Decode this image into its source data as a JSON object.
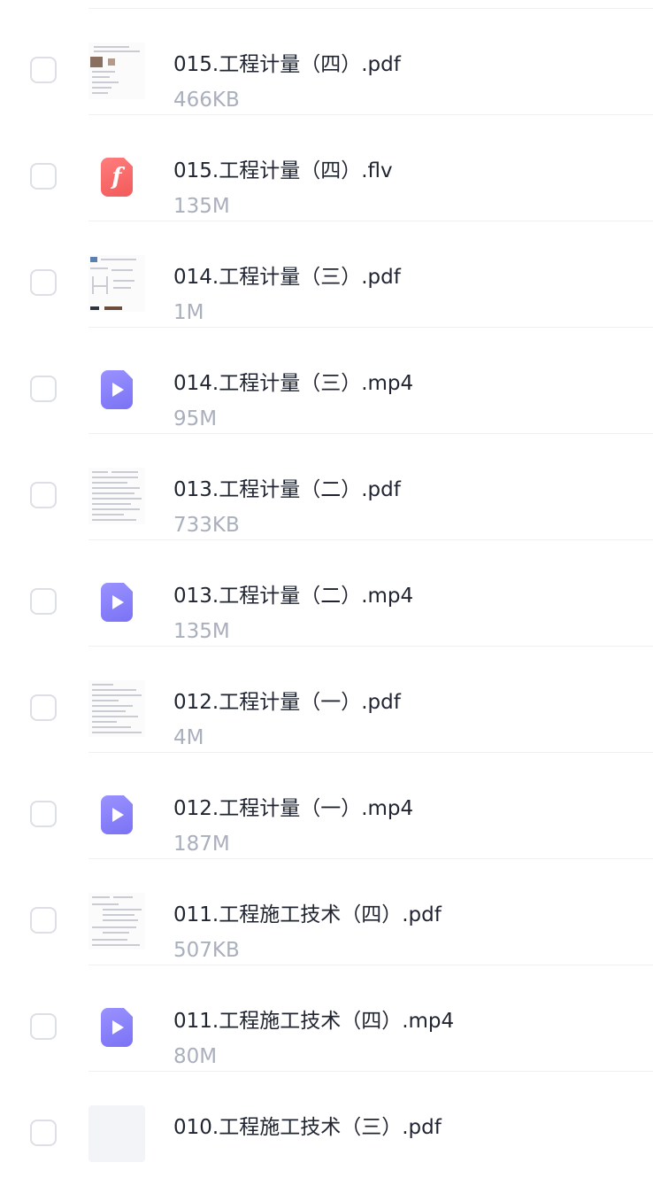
{
  "files": [
    {
      "name": "015.工程计量（四）.pdf",
      "size": "466KB",
      "icon": "pdf-thumbnail"
    },
    {
      "name": "015.工程计量（四）.flv",
      "size": "135M",
      "icon": "flash-file-icon"
    },
    {
      "name": "014.工程计量（三）.pdf",
      "size": "1M",
      "icon": "pdf-thumbnail"
    },
    {
      "name": "014.工程计量（三）.mp4",
      "size": "95M",
      "icon": "video-file-icon"
    },
    {
      "name": "013.工程计量（二）.pdf",
      "size": "733KB",
      "icon": "pdf-thumbnail"
    },
    {
      "name": "013.工程计量（二）.mp4",
      "size": "135M",
      "icon": "video-file-icon"
    },
    {
      "name": "012.工程计量（一）.pdf",
      "size": "4M",
      "icon": "pdf-thumbnail"
    },
    {
      "name": "012.工程计量（一）.mp4",
      "size": "187M",
      "icon": "video-file-icon"
    },
    {
      "name": "011.工程施工技术（四）.pdf",
      "size": "507KB",
      "icon": "pdf-thumbnail"
    },
    {
      "name": "011.工程施工技术（四）.mp4",
      "size": "80M",
      "icon": "video-file-icon"
    },
    {
      "name": "010.工程施工技术（三）.pdf",
      "size": "",
      "icon": "pdf-thumbnail"
    }
  ],
  "colors": {
    "video_icon": "#8a82fb",
    "flash_icon": "#f56a6a",
    "filename_text": "#1f2430",
    "filesize_text": "#a9afbd",
    "checkbox_border": "#dcdfe6"
  }
}
